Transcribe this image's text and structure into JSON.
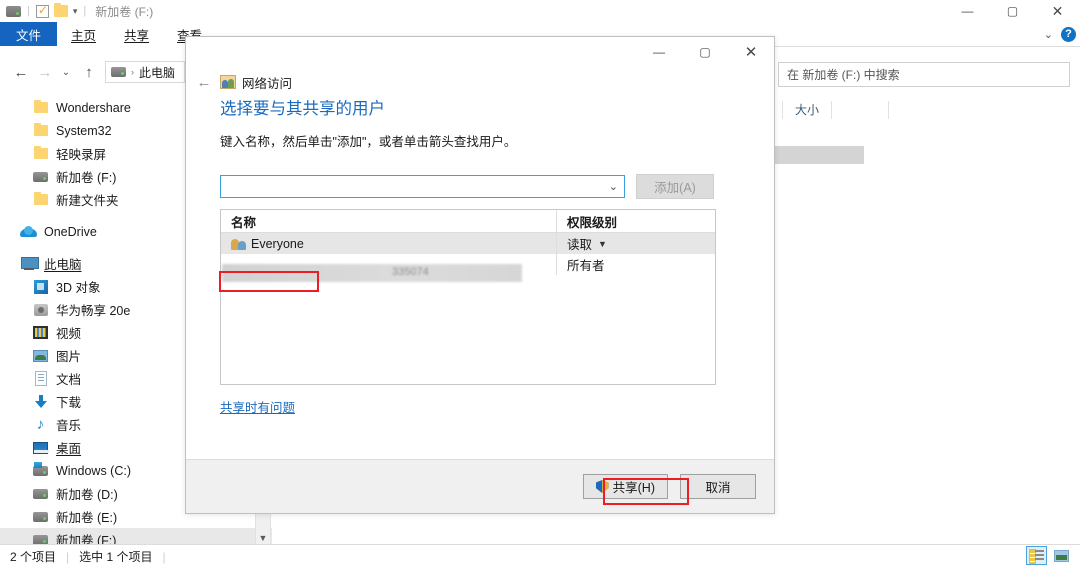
{
  "window": {
    "title": "新加卷 (F:)",
    "quick_access": [
      {
        "name": "drive-icon",
        "label": ""
      },
      {
        "name": "properties-icon",
        "label": ""
      },
      {
        "name": "new-folder-icon",
        "label": ""
      },
      {
        "name": "chevron-down-icon",
        "label": "▾"
      }
    ],
    "controls": {
      "minimize": "—",
      "maximize": "▢",
      "close": "✕"
    }
  },
  "ribbon": {
    "tabs": [
      {
        "label": "文件",
        "active": true
      },
      {
        "label": "主页",
        "active": false
      },
      {
        "label": "共享",
        "active": false
      },
      {
        "label": "查看",
        "active": false
      }
    ],
    "collapse_caret": "⌄",
    "help_label": "?"
  },
  "navbar": {
    "back": "←",
    "forward": "→",
    "recent": "⌄",
    "up": "↑",
    "breadcrumb_sep": "›",
    "breadcrumb": "此电脑"
  },
  "search": {
    "placeholder": "在 新加卷 (F:) 中搜索",
    "value": "在 新加卷 (F:) 中搜索"
  },
  "file_list": {
    "columns": [
      "大小",
      ""
    ]
  },
  "sidebar": {
    "items": [
      {
        "label": "Wondershare",
        "icon": "folder-icon",
        "indent": 1,
        "selected": false
      },
      {
        "label": "System32",
        "icon": "folder-icon",
        "indent": 1,
        "selected": false
      },
      {
        "label": "轻映录屏",
        "icon": "folder-icon",
        "indent": 1,
        "selected": false
      },
      {
        "label": "新加卷 (F:)",
        "icon": "drive-icon",
        "indent": 1,
        "selected": false
      },
      {
        "label": "新建文件夹",
        "icon": "folder-icon",
        "indent": 1,
        "selected": false
      },
      {
        "label": "OneDrive",
        "icon": "cloud-icon",
        "indent": 0,
        "selected": false
      },
      {
        "label": "此电脑",
        "icon": "computer-icon",
        "indent": 0,
        "selected": false,
        "underline": true
      },
      {
        "label": "3D 对象",
        "icon": "3d-objects-icon",
        "indent": 1,
        "selected": false
      },
      {
        "label": "华为畅享 20e",
        "icon": "phone-icon",
        "indent": 1,
        "selected": false
      },
      {
        "label": "视频",
        "icon": "videos-icon",
        "indent": 1,
        "selected": false
      },
      {
        "label": "图片",
        "icon": "pictures-icon",
        "indent": 1,
        "selected": false
      },
      {
        "label": "文档",
        "icon": "documents-icon",
        "indent": 1,
        "selected": false
      },
      {
        "label": "下载",
        "icon": "downloads-icon",
        "indent": 1,
        "selected": false
      },
      {
        "label": "音乐",
        "icon": "music-icon",
        "indent": 1,
        "selected": false
      },
      {
        "label": "桌面",
        "icon": "desktop-icon",
        "indent": 1,
        "selected": false,
        "underline": true
      },
      {
        "label": "Windows (C:)",
        "icon": "windows-drive-icon",
        "indent": 1,
        "selected": false
      },
      {
        "label": "新加卷 (D:)",
        "icon": "drive-icon",
        "indent": 1,
        "selected": false
      },
      {
        "label": "新加卷 (E:)",
        "icon": "drive-icon",
        "indent": 1,
        "selected": false
      },
      {
        "label": "新加卷 (F:)",
        "icon": "drive-icon",
        "indent": 1,
        "selected": true
      }
    ],
    "scroll_down_arrow": "▼"
  },
  "statusbar": {
    "item_count": "2 个项目",
    "selection": "选中 1 个项目",
    "view_details_icon": "details-view-icon",
    "view_large_icon": "large-icons-view-icon"
  },
  "dialog": {
    "controls": {
      "minimize": "—",
      "maximize": "▢",
      "close": "✕"
    },
    "back": "←",
    "header_icon": "network-users-icon",
    "header_title": "网络访问",
    "heading": "选择要与其共享的用户",
    "subtext": "键入名称，然后单击\"添加\"，或者单击箭头查找用户。",
    "combo": {
      "value": "",
      "caret": "⌄"
    },
    "add_button": {
      "label": "添加(A)",
      "disabled": true
    },
    "table": {
      "columns": [
        "名称",
        "权限级别"
      ],
      "rows": [
        {
          "name": "Everyone",
          "permission": "读取",
          "has_caret": true,
          "selected": true,
          "redacted": false
        },
        {
          "name": "",
          "permission": "所有者",
          "has_caret": false,
          "selected": false,
          "redacted": true
        }
      ]
    },
    "help_link": "共享时有问题",
    "share_button": "共享(H)",
    "cancel_button": "取消"
  },
  "annotations": {
    "accent_red": "#ee1c25",
    "boxes": [
      "everyone-row-highlight",
      "share-button-highlight"
    ]
  }
}
